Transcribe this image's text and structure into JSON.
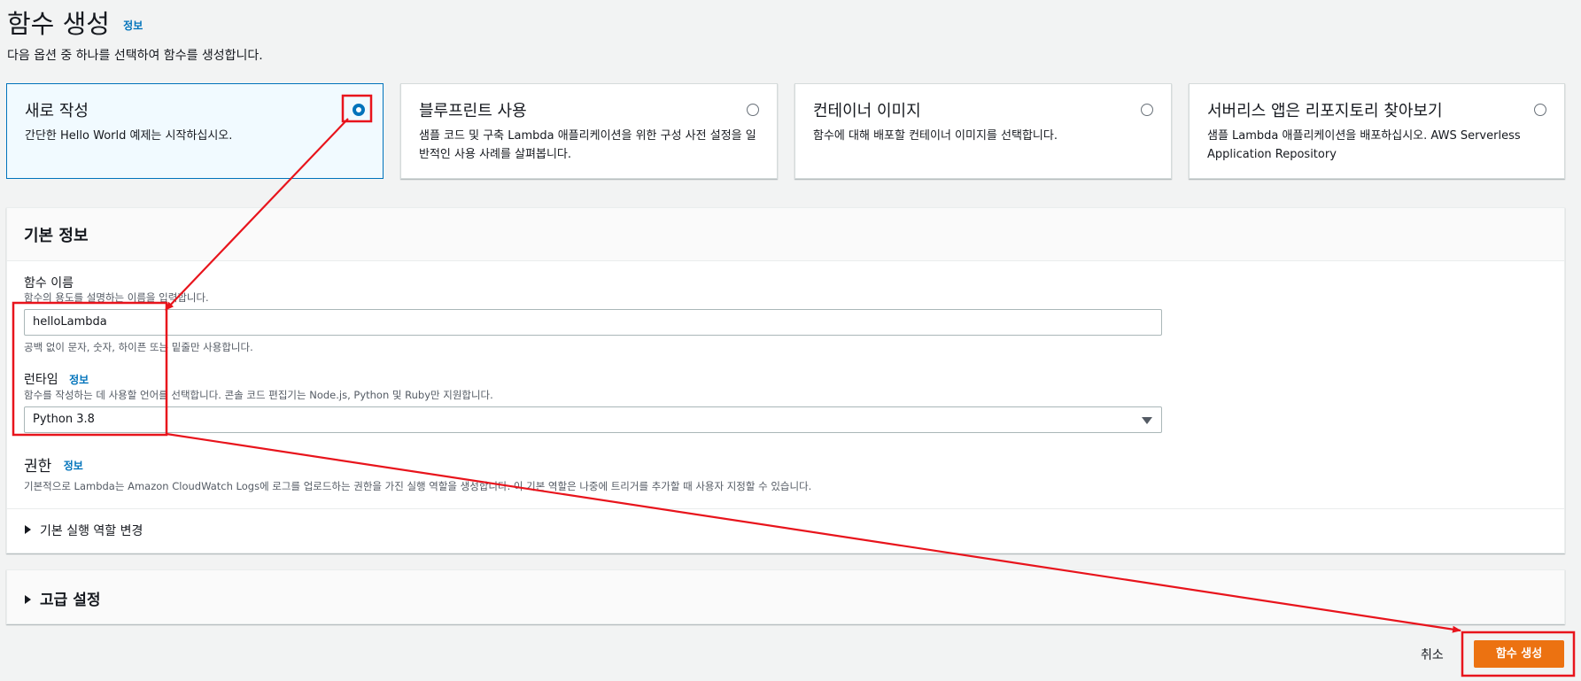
{
  "header": {
    "title": "함수 생성",
    "info_label": "정보",
    "subtitle": "다음 옵션 중 하나를 선택하여 함수를 생성합니다."
  },
  "options": [
    {
      "title": "새로 작성",
      "desc": "간단한 Hello World 예제는 시작하십시오.",
      "selected": true
    },
    {
      "title": "블루프린트 사용",
      "desc": "샘플 코드 및 구축 Lambda 애플리케이션을 위한 구성 사전 설정을 일반적인 사용 사례를 살펴봅니다.",
      "selected": false
    },
    {
      "title": "컨테이너 이미지",
      "desc": "함수에 대해 배포할 컨테이너 이미지를 선택합니다.",
      "selected": false
    },
    {
      "title": "서버리스 앱은 리포지토리 찾아보기",
      "desc": "샘플 Lambda 애플리케이션을 배포하십시오. AWS Serverless Application Repository",
      "selected": false
    }
  ],
  "basic_info": {
    "title": "기본 정보",
    "function_name": {
      "label": "함수 이름",
      "desc": "함수의 용도를 설명하는 이름을 입력합니다.",
      "value": "helloLambda",
      "hint": "공백 없이 문자, 숫자, 하이픈 또는 밑줄만 사용합니다."
    },
    "runtime": {
      "label": "런타임",
      "info_label": "정보",
      "desc": "함수를 작성하는 데 사용할 언어를 선택합니다. 콘솔 코드 편집기는 Node.js, Python 및 Ruby만 지원합니다.",
      "value": "Python 3.8"
    },
    "permissions": {
      "label": "권한",
      "info_label": "정보",
      "desc": "기본적으로 Lambda는 Amazon CloudWatch Logs에 로그를 업로드하는 권한을 가진 실행 역할을 생성합니다. 이 기본 역할은 나중에 트리거를 추가할 때 사용자 지정할 수 있습니다.",
      "expand_label": "기본 실행 역할 변경"
    }
  },
  "advanced": {
    "title": "고급 설정"
  },
  "footer": {
    "cancel_label": "취소",
    "create_label": "함수 생성"
  },
  "colors": {
    "accent": "#0073bb",
    "primary_button": "#ec7211",
    "annotation": "#e8141c"
  }
}
